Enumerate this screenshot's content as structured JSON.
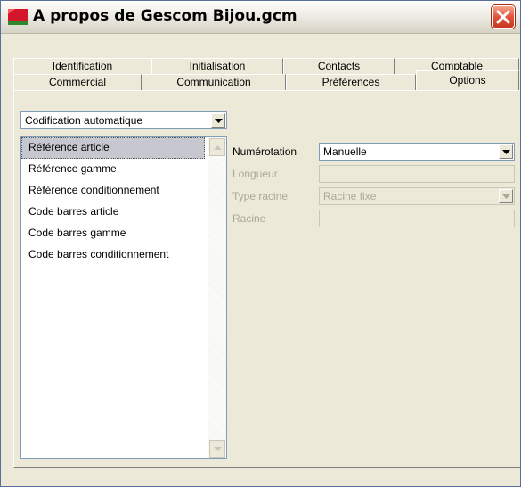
{
  "window": {
    "title": "A propos de Gescom Bijou.gcm",
    "app_icon": "app-icon",
    "close_icon": "close-icon"
  },
  "tabs": {
    "row1": [
      "Identification",
      "Initialisation",
      "Contacts",
      "Comptable"
    ],
    "row2": [
      "Commercial",
      "Communication",
      "Préférences",
      "Options"
    ],
    "active": "Options"
  },
  "options": {
    "category_combo": {
      "value": "Codification automatique",
      "icon": "chevron-down-icon"
    },
    "codes_list": {
      "items": [
        "Référence article",
        "Référence gamme",
        "Référence conditionnement",
        "Code barres article",
        "Code barres gamme",
        "Code barres conditionnement"
      ],
      "selected_index": 0
    },
    "numerotation": {
      "label": "Numérotation",
      "value": "Manuelle"
    },
    "longueur": {
      "label": "Longueur",
      "value": ""
    },
    "type_racine": {
      "label": "Type racine",
      "value": "Racine fixe"
    },
    "racine": {
      "label": "Racine",
      "value": ""
    }
  }
}
